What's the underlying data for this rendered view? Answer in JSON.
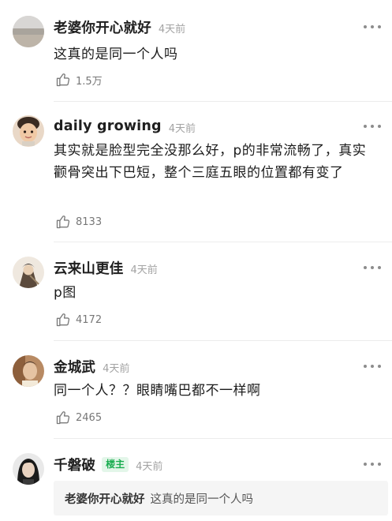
{
  "comments": [
    {
      "user": "老婆你开心就好",
      "time": "4天前",
      "text": "这真的是同一个人吗",
      "likes": "1.5万",
      "avatar_icon": "beach-photo-avatar"
    },
    {
      "user": "daily growing",
      "time": "4天前",
      "text": "其实就是脸型完全没那么好，p的非常流畅了，真实颧骨突出下巴短，整个三庭五眼的位置都有变了",
      "likes": "8133",
      "avatar_icon": "child-face-avatar"
    },
    {
      "user": "云来山更佳",
      "time": "4天前",
      "text": "p图",
      "likes": "4172",
      "avatar_icon": "illustrated-figure-avatar"
    },
    {
      "user": "金城武",
      "time": "4天前",
      "text": "同一个人？？眼睛嘴巴都不一样啊",
      "likes": "2465",
      "avatar_icon": "portrait-avatar"
    }
  ],
  "op_reply": {
    "user": "千磐破",
    "badge": "楼主",
    "time": "4天前",
    "quote_author": "老婆你开心就好",
    "quote_text": "这真的是同一个人吗",
    "avatar_icon": "dark-hair-avatar"
  },
  "colors": {
    "badge_green": "#1aad50",
    "badge_bg": "#e3f6e9",
    "muted": "#a3a3a3"
  }
}
